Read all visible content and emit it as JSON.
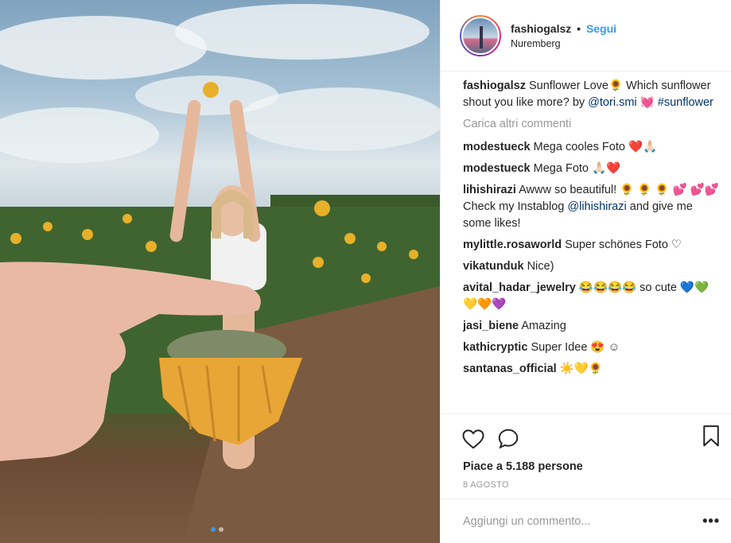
{
  "post": {
    "username": "fashiogalsz",
    "separator": "•",
    "follow_label": "Segui",
    "location": "Nuremberg",
    "caption": {
      "user": "fashiogalsz",
      "text_1": "Sunflower Love🌻 Which sunflower shout you like more? by",
      "mention": "@tori.smi",
      "text_2": "💓",
      "hashtag": "#sunflower"
    },
    "load_more": "Carica altri commenti",
    "comments": [
      {
        "user": "modestueck",
        "text": "Mega cooles Foto ❤️🙏🏻"
      },
      {
        "user": "modestueck",
        "text": "Mega Foto 🙏🏻❤️"
      },
      {
        "user": "lihishirazi",
        "text_1": "Awww so beautiful! 🌻 🌻 🌻 💕 💕💕 Check my Instablog",
        "mention": "@lihishirazi",
        "text_2": "and give me some likes!"
      },
      {
        "user": "mylittle.rosaworld",
        "text": "Super schönes Foto ♡"
      },
      {
        "user": "vikatunduk",
        "text": "Nice)"
      },
      {
        "user": "avital_hadar_jewelry",
        "text": "😂😂😂😂 so cute 💙💚💛🧡💜"
      },
      {
        "user": "jasi_biene",
        "text": "Amazing"
      },
      {
        "user": "kathicryptic",
        "text": "Super Idee 😍 ☺"
      },
      {
        "user": "santanas_official",
        "text": "☀️💛🌻"
      }
    ],
    "likes": "Piace a 5.188 persone",
    "date": "8 AGOSTO",
    "add_comment_placeholder": "Aggiungi un commento...",
    "more_label": "•••"
  },
  "icons": {
    "like": "heart-icon",
    "comment": "comment-bubble-icon",
    "save": "bookmark-icon"
  }
}
